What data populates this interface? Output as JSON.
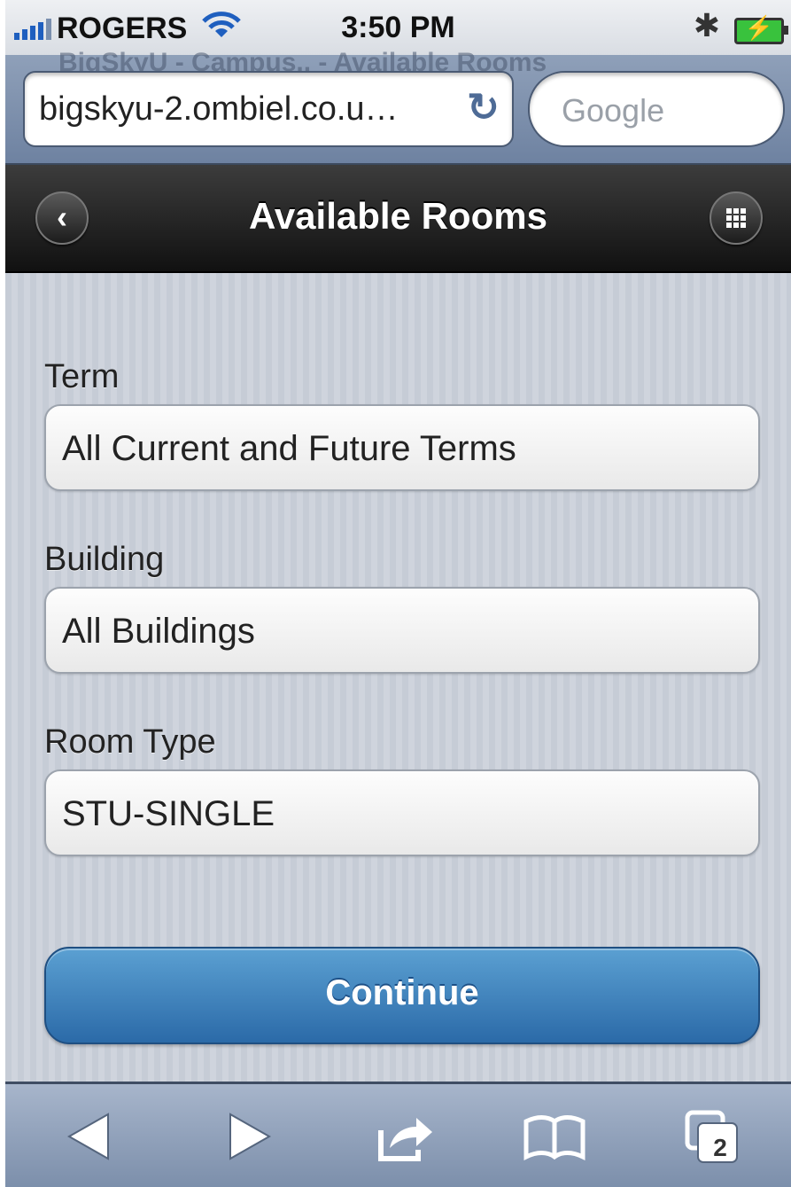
{
  "status": {
    "carrier": "ROGERS",
    "time": "3:50 PM"
  },
  "browser": {
    "page_title_behind": "BigSkyU - Campus.. - Available Rooms",
    "url": "bigskyu-2.ombiel.co.u…",
    "search_placeholder": "Google"
  },
  "header": {
    "title": "Available Rooms"
  },
  "form": {
    "fields": [
      {
        "label": "Term",
        "value": "All Current and Future Terms"
      },
      {
        "label": "Building",
        "value": "All Buildings"
      },
      {
        "label": "Room Type",
        "value": "STU-SINGLE"
      }
    ],
    "continue_label": "Continue"
  },
  "toolbar": {
    "tab_count": "2"
  }
}
